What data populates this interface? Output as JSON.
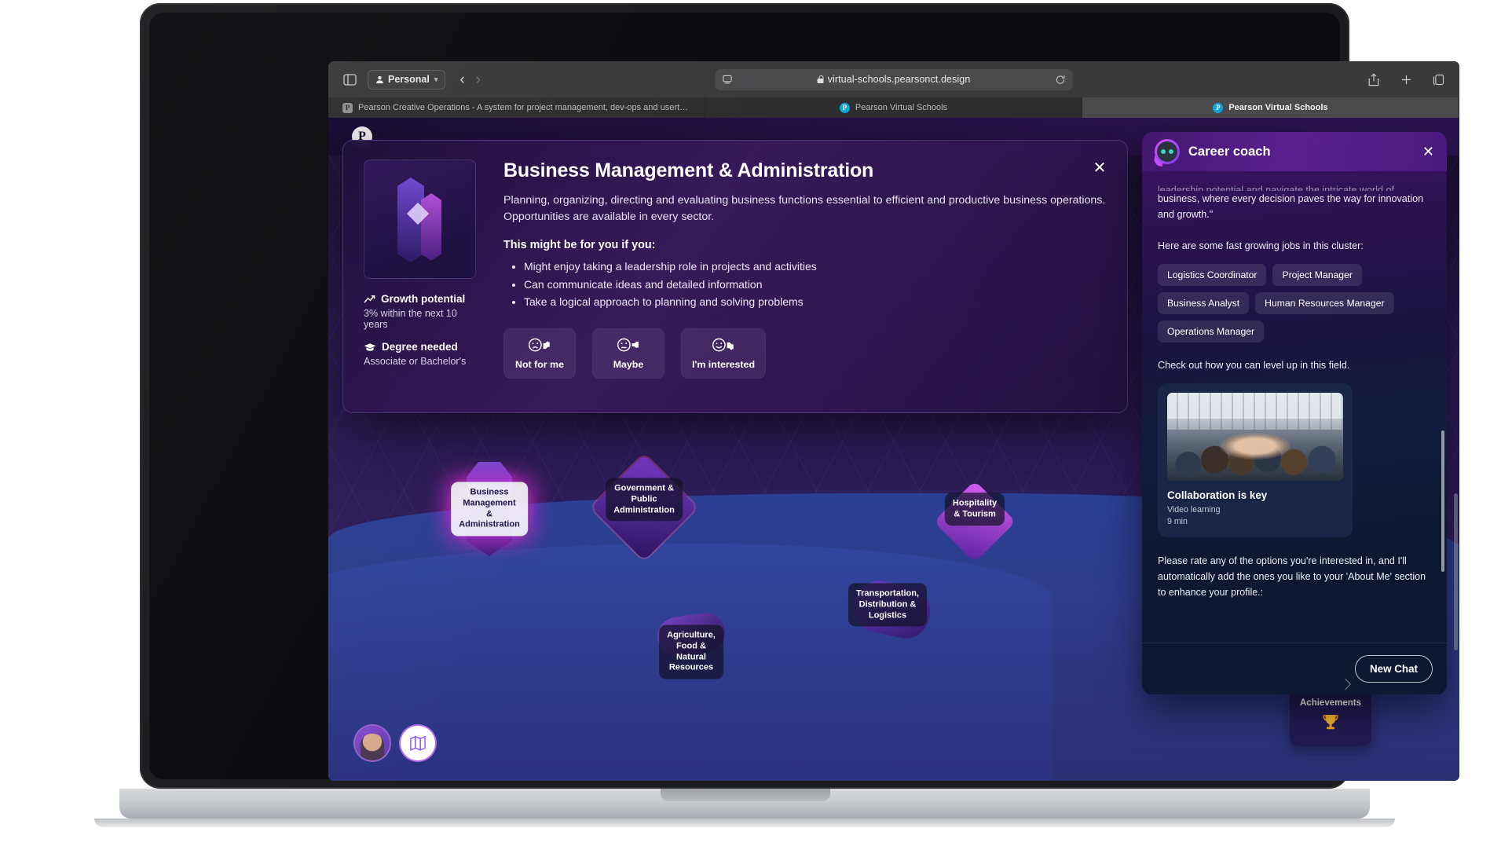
{
  "browser": {
    "profile_label": "Personal",
    "url": "virtual-schools.pearsonct.design",
    "back_icon": "chevron-left-icon",
    "forward_icon": "chevron-right-icon",
    "sidebar_icon": "sidebar-toggle-icon",
    "reader_icon": "reader-view-icon",
    "reload_icon": "reload-icon",
    "share_icon": "share-icon",
    "newtab_icon": "plus-icon",
    "tabs_overview_icon": "tab-overview-icon",
    "tabs": [
      {
        "title": "Pearson Creative Operations - A system for project management, dev-ops and usertesting.",
        "favicon": "P",
        "active": false
      },
      {
        "title": "Pearson Virtual Schools",
        "favicon": "P",
        "active": false
      },
      {
        "title": "Pearson Virtual Schools",
        "favicon": "P",
        "active": true
      }
    ]
  },
  "app": {
    "logo_letter": "P"
  },
  "modal": {
    "close_icon": "close-icon",
    "title": "Business Management & Administration",
    "description": "Planning, organizing, directing and evaluating business functions essential to efficient and productive business operations. Opportunities are available in every sector.",
    "subtitle": "This might be for you if you:",
    "bullets": [
      "Might enjoy taking a leadership role in projects and activities",
      "Can communicate ideas and detailed information",
      "Take a logical approach to planning and solving problems"
    ],
    "meta": [
      {
        "icon": "trending-up-icon",
        "title": "Growth potential",
        "value": "3% within the next 10 years"
      },
      {
        "icon": "graduation-cap-icon",
        "title": "Degree needed",
        "value": "Associate or Bachelor's"
      }
    ],
    "rate_buttons": [
      {
        "icon": "sad-face-thumbs-down-icon",
        "label": "Not for me"
      },
      {
        "icon": "neutral-face-thumb-side-icon",
        "label": "Maybe"
      },
      {
        "icon": "happy-face-thumbs-up-icon",
        "label": "I'm interested"
      }
    ]
  },
  "map": {
    "nodes": [
      {
        "label": "Business\nManagement &\nAdministration",
        "style": "light"
      },
      {
        "label": "Government &\nPublic\nAdministration",
        "style": "dark"
      },
      {
        "label": "Hospitality\n& Tourism",
        "style": "dark"
      },
      {
        "label": "Transportation,\nDistribution &\nLogistics",
        "style": "dark"
      },
      {
        "label": "Agriculture, Food &\nNatural Resources",
        "style": "dark"
      }
    ],
    "achievements": {
      "label": "Achievements",
      "icon": "trophy-icon"
    },
    "avatar_button": "profile-avatar-button",
    "map_button": "map-icon"
  },
  "coach": {
    "title": "Career coach",
    "avatar_icon": "coach-avatar-icon",
    "close_icon": "close-icon",
    "message_clipped": "leadership potential and navigate the intricate world of",
    "message_rest": "business, where every decision paves the way for innovation and growth.\"",
    "jobs_intro": "Here are some fast growing jobs in this cluster:",
    "jobs": [
      "Logistics Coordinator",
      "Project Manager",
      "Business Analyst",
      "Human Resources Manager",
      "Operations Manager"
    ],
    "level_up_text": "Check out how you can level up in this field.",
    "video": {
      "title": "Collaboration is key",
      "type": "Video learning",
      "duration": "9 min"
    },
    "closing_text": "Please rate any of the options you're interested in, and I'll automatically add the ones you like to your 'About Me' section to enhance your profile.:",
    "new_chat_label": "New Chat"
  },
  "colors": {
    "accent_magenta": "#e828d2",
    "coach_purple": "#5b2090",
    "panel_navy": "#0e1833",
    "trophy_gold": "#f5a623"
  }
}
